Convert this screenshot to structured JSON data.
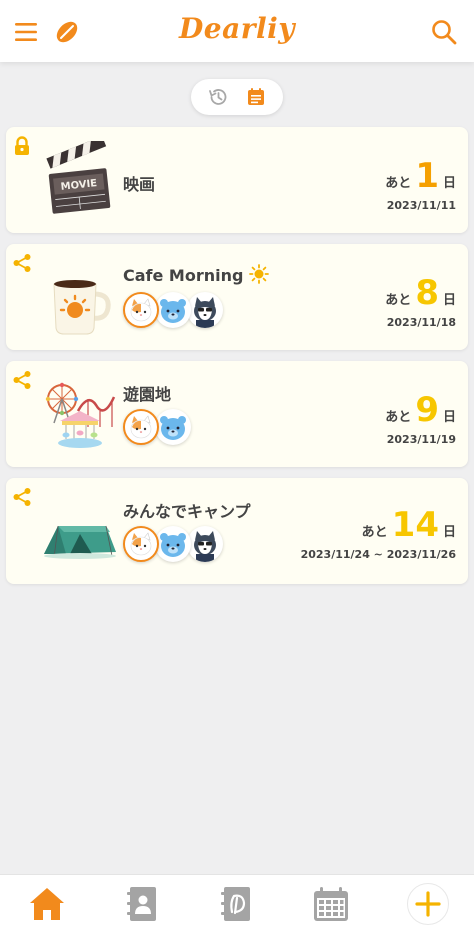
{
  "app": {
    "title": "Dearliy"
  },
  "colors": {
    "accent": "#f28a1c",
    "number_orange": "#f5a000",
    "number_yellow": "#f7c600",
    "card_bg": "#fffef3",
    "icon_gray": "#9a9a9a"
  },
  "header": {
    "menu_icon": "hamburger-icon",
    "leaf_icon": "leaf-icon",
    "search_icon": "search-icon"
  },
  "view_toggle": {
    "history_icon": "history-icon",
    "calendar_icon": "calendar-list-icon",
    "selected": "calendar"
  },
  "events": [
    {
      "title": "映画",
      "corner_icon": "lock-icon",
      "thumb_icon": "clapperboard-icon",
      "prefix": "あと",
      "days": "1",
      "unit": "日",
      "date": "2023/11/11",
      "avatars": []
    },
    {
      "title": "Cafe Morning",
      "title_suffix_icon": "sun-icon",
      "corner_icon": "share-icon",
      "thumb_icon": "coffee-mug-icon",
      "prefix": "あと",
      "days": "8",
      "unit": "日",
      "date": "2023/11/18",
      "avatars": [
        "cat-avatar",
        "blue-bear-avatar",
        "husky-avatar"
      ]
    },
    {
      "title": "遊園地",
      "corner_icon": "share-icon",
      "thumb_icon": "amusement-park-icon",
      "prefix": "あと",
      "days": "9",
      "unit": "日",
      "date": "2023/11/19",
      "avatars": [
        "cat-avatar",
        "blue-bear-avatar"
      ]
    },
    {
      "title": "みんなでキャンプ",
      "corner_icon": "share-icon",
      "thumb_icon": "tent-icon",
      "prefix": "あと",
      "days": "14",
      "unit": "日",
      "date": "2023/11/24 ~ 2023/11/26",
      "avatars": [
        "cat-avatar",
        "blue-bear-avatar",
        "husky-avatar"
      ]
    }
  ],
  "bottom_nav": [
    {
      "icon": "home-icon",
      "active": true
    },
    {
      "icon": "contacts-book-icon",
      "active": false
    },
    {
      "icon": "diary-icon",
      "active": false
    },
    {
      "icon": "calendar-icon",
      "active": false
    },
    {
      "icon": "add-icon",
      "active": false
    }
  ]
}
